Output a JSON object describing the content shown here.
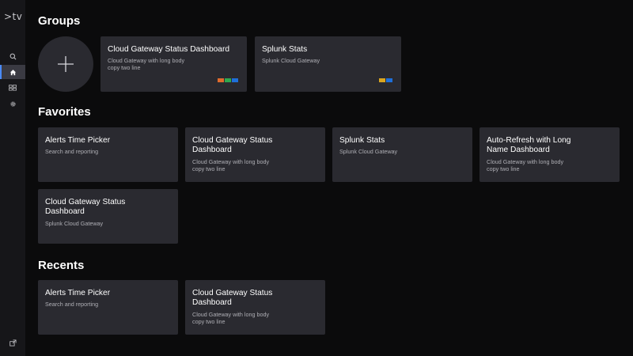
{
  "sidebar": {
    "logo": ">tv",
    "items": [
      {
        "icon": "search-icon"
      },
      {
        "icon": "home-icon",
        "active": true
      },
      {
        "icon": "dashboard-grid-icon"
      },
      {
        "icon": "gear-icon"
      }
    ],
    "bottom_icon": "external-link-icon"
  },
  "colors": {
    "accent": "#4a8bff",
    "card": "#2a2a30",
    "swatch_orange": "#e06b2d",
    "swatch_green": "#2fa84f",
    "swatch_blue": "#1e6fd9",
    "swatch_yellow": "#d9a520"
  },
  "groups": {
    "title": "Groups",
    "cards": [
      {
        "title": "Cloud Gateway Status Dashboard",
        "desc": "Cloud Gateway with long body copy two line"
      },
      {
        "title": "Splunk Stats",
        "desc": "Splunk Cloud Gateway"
      }
    ]
  },
  "favorites": {
    "title": "Favorites",
    "cards": [
      {
        "title": "Alerts Time Picker",
        "desc": "Search and reporting"
      },
      {
        "title": "Cloud Gateway Status Dashboard",
        "desc": "Cloud Gateway with long body copy two line"
      },
      {
        "title": "Splunk Stats",
        "desc": "Splunk Cloud Gateway"
      },
      {
        "title": "Auto-Refresh with Long Name Dashboard",
        "desc": "Cloud Gateway with long body copy two line"
      },
      {
        "title": "Cloud Gateway Status Dashboard",
        "desc": "Splunk Cloud Gateway"
      }
    ]
  },
  "recents": {
    "title": "Recents",
    "cards": [
      {
        "title": "Alerts Time Picker",
        "desc": "Search and reporting"
      },
      {
        "title": "Cloud Gateway Status Dashboard",
        "desc": "Cloud Gateway with long body copy two line"
      }
    ]
  }
}
